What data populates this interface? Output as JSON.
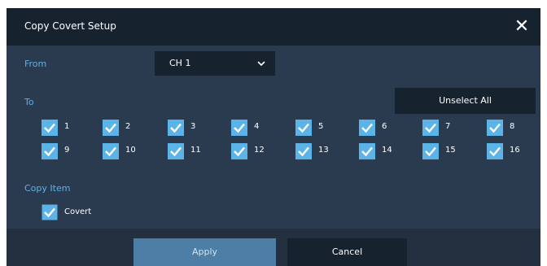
{
  "dialog": {
    "title": "Copy Covert Setup",
    "close_label": "✕"
  },
  "from": {
    "label": "From",
    "value": "CH 1"
  },
  "to": {
    "label": "To",
    "unselect_all_label": "Unselect All",
    "channels": [
      {
        "label": "1",
        "checked": true
      },
      {
        "label": "2",
        "checked": true
      },
      {
        "label": "3",
        "checked": true
      },
      {
        "label": "4",
        "checked": true
      },
      {
        "label": "5",
        "checked": true
      },
      {
        "label": "6",
        "checked": true
      },
      {
        "label": "7",
        "checked": true
      },
      {
        "label": "8",
        "checked": true
      },
      {
        "label": "9",
        "checked": true
      },
      {
        "label": "10",
        "checked": true
      },
      {
        "label": "11",
        "checked": true
      },
      {
        "label": "12",
        "checked": true
      },
      {
        "label": "13",
        "checked": true
      },
      {
        "label": "14",
        "checked": true
      },
      {
        "label": "15",
        "checked": true
      },
      {
        "label": "16",
        "checked": true
      }
    ]
  },
  "copy_item": {
    "label": "Copy Item",
    "covert_label": "Covert",
    "covert_checked": true
  },
  "buttons": {
    "apply_label": "Apply",
    "cancel_label": "Cancel"
  },
  "colors": {
    "accent": "#5bb3e8",
    "panel": "#2a3b4f",
    "dark": "#17222f",
    "apply": "#4d7fa6"
  }
}
